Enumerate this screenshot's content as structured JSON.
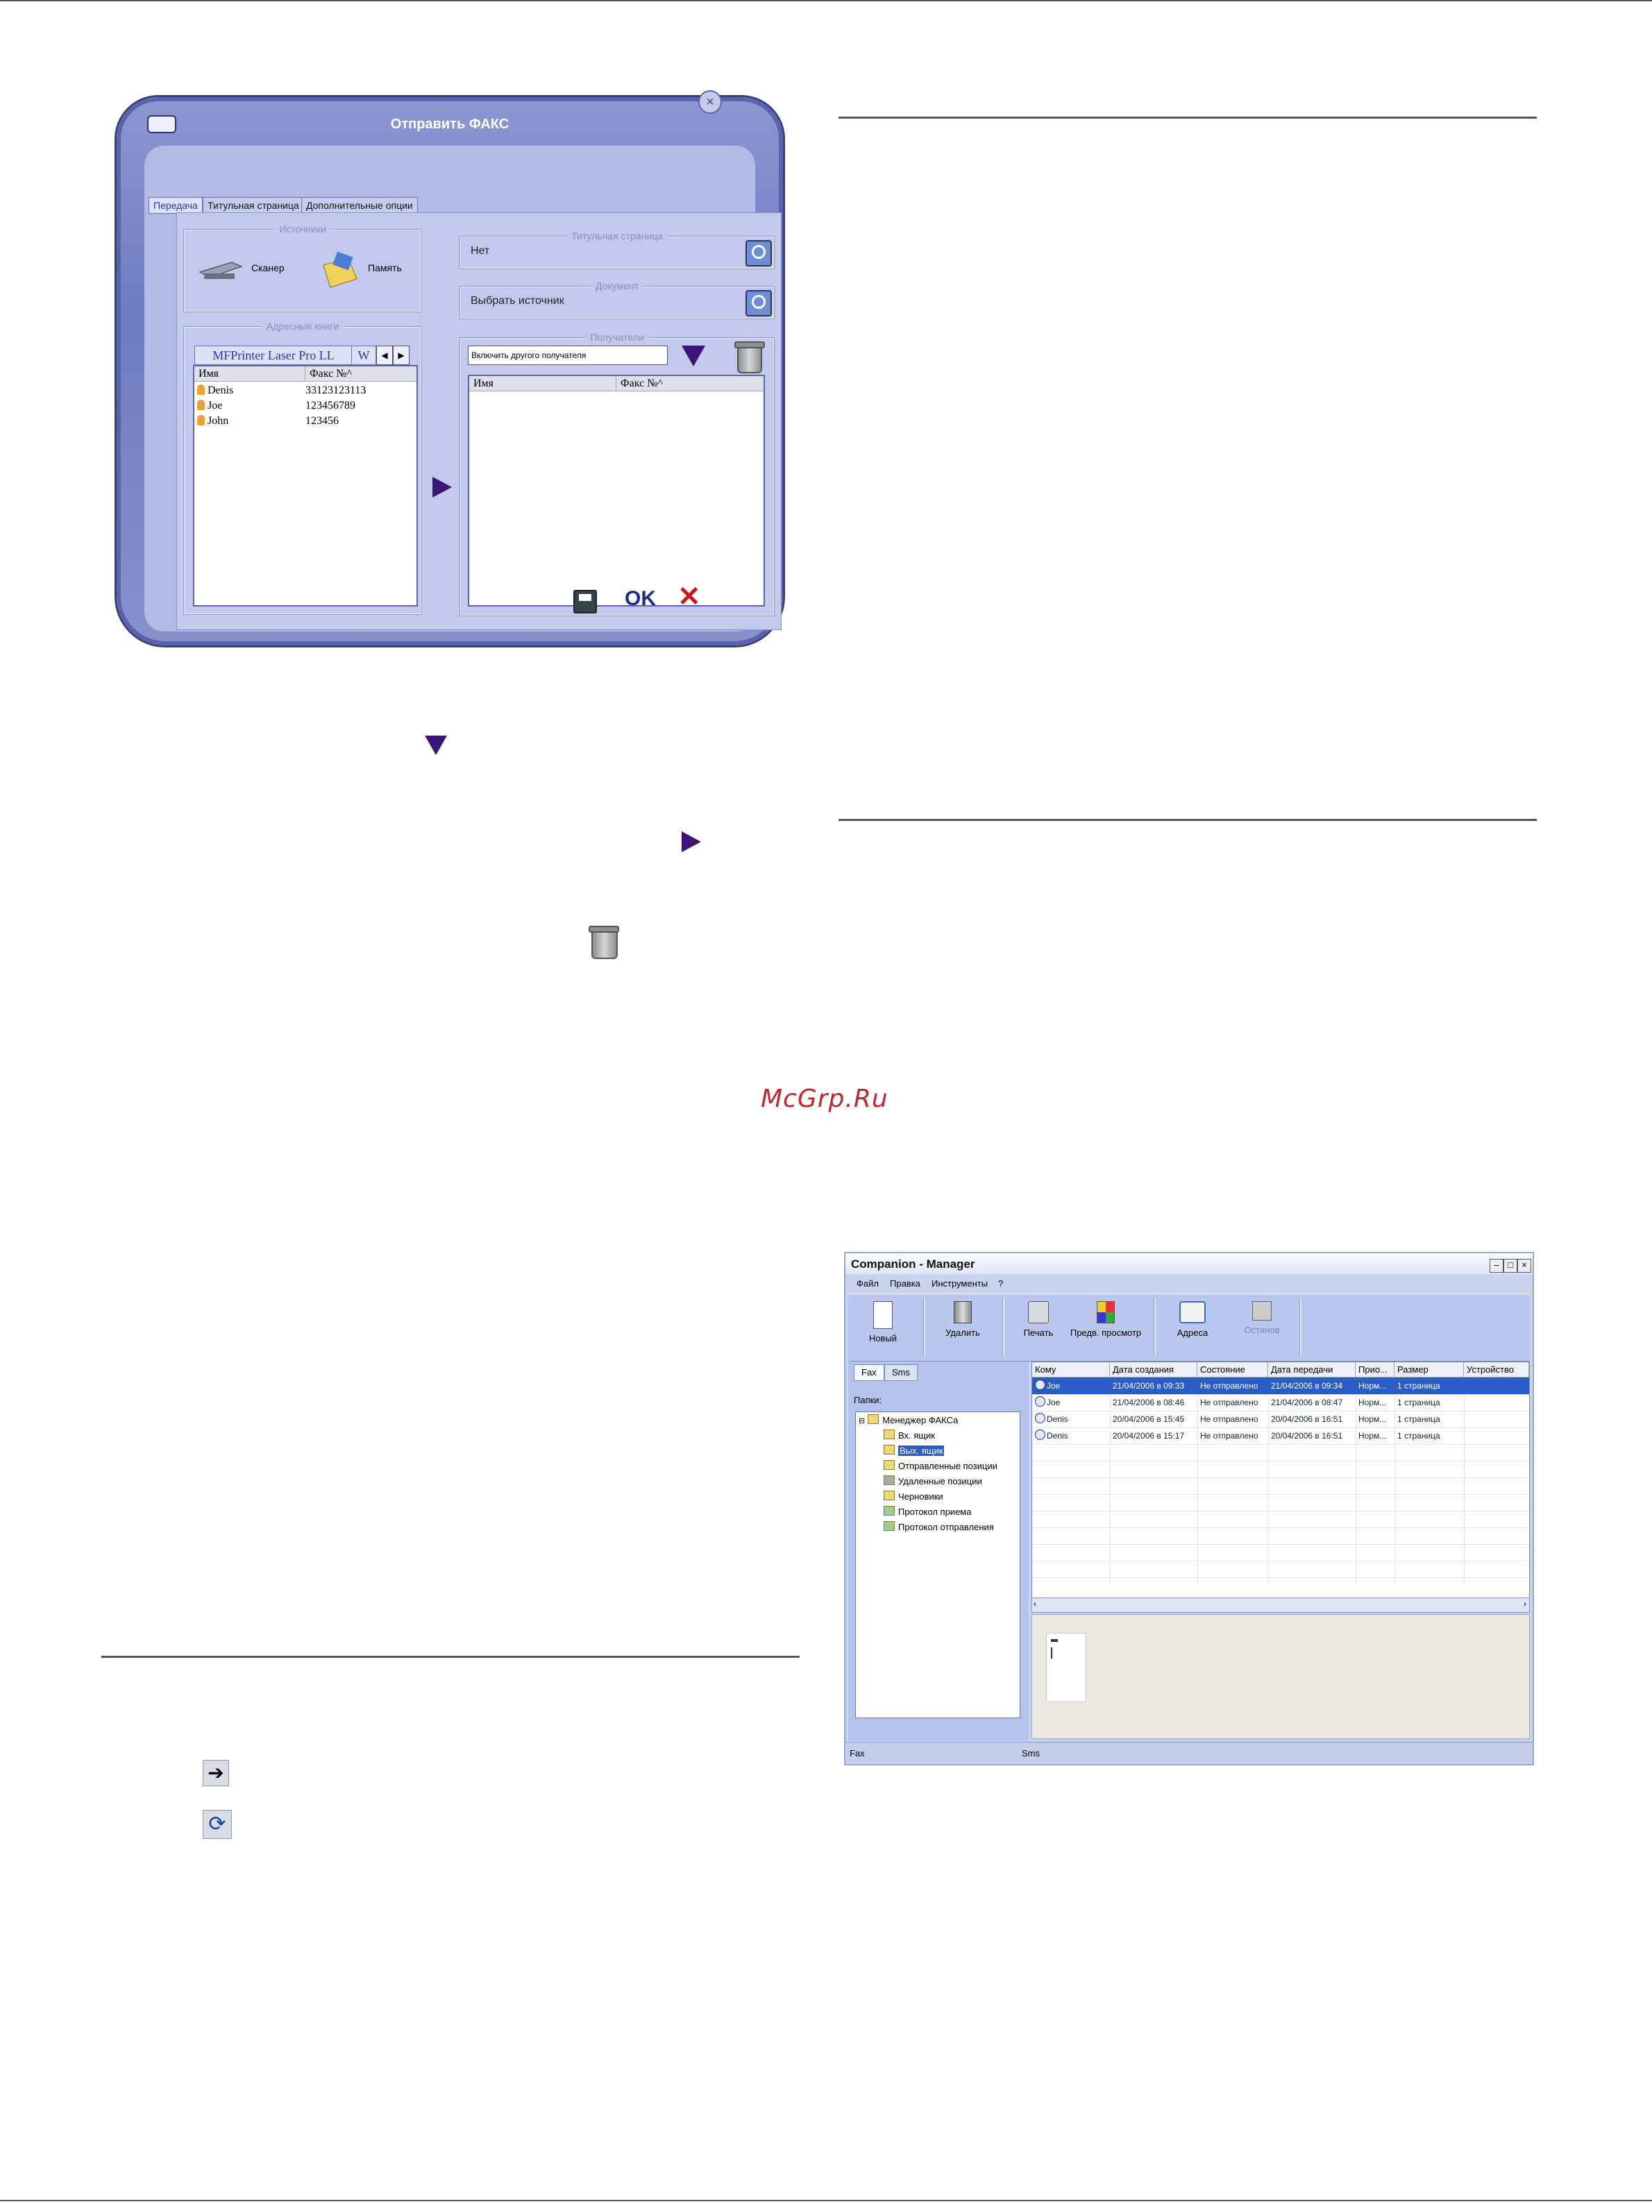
{
  "watermark": "McGrp.Ru",
  "fax_dialog": {
    "title": "Отправить ФАКС",
    "tabs": [
      "Передача",
      "Титульная страница",
      "Дополнительные опции"
    ],
    "sources": {
      "caption": "Источники",
      "scanner": "Сканер",
      "memory": "Память"
    },
    "address_books": {
      "caption": "Адресные книги",
      "book_tab": "MFPrinter Laser Pro LL",
      "book_tab_more": "W",
      "headers": [
        "Имя",
        "Факс №^"
      ],
      "rows": [
        {
          "name": "Denis",
          "fax": "33123123113"
        },
        {
          "name": "Joe",
          "fax": "123456789"
        },
        {
          "name": "John",
          "fax": "123456"
        }
      ]
    },
    "cover_page": {
      "caption": "Титульная страница",
      "value": "Нет"
    },
    "document": {
      "caption": "Документ",
      "value": "Выбрать источник"
    },
    "recipients": {
      "caption": "Получатели",
      "placeholder": "Включить другого получателя",
      "headers": [
        "Имя",
        "Факс №^"
      ]
    },
    "ok_label": "OK"
  },
  "companion_manager": {
    "title": "Companion - Manager",
    "menu": [
      "Файл",
      "Правка",
      "Инструменты",
      "?"
    ],
    "toolbar": [
      "Новый",
      "Удалить",
      "Печать",
      "Предв. просмотр",
      "Адреса",
      "Останов"
    ],
    "side_tabs": [
      "Fax",
      "Sms"
    ],
    "folders_label": "Папки:",
    "tree_root": "Менеджер ФАКСа",
    "tree_items": [
      "Вх. ящик",
      "Вых. ящик",
      "Отправленные позиции",
      "Удаленные позиции",
      "Черновики",
      "Протокол приема",
      "Протокол отправления"
    ],
    "columns": [
      "Кому",
      "Дата создания",
      "Состояние",
      "Дата передачи",
      "Прио...",
      "Размер",
      "Устройство"
    ],
    "rows": [
      [
        "Joe",
        "21/04/2006 в 09:33",
        "Не отправлено",
        "21/04/2006 в 09:34",
        "Норм...",
        "1 страница",
        ""
      ],
      [
        "Joe",
        "21/04/2006 в 08:46",
        "Не отправлено",
        "21/04/2006 в 08:47",
        "Норм...",
        "1 страница",
        ""
      ],
      [
        "Denis",
        "20/04/2006 в 15:45",
        "Не отправлено",
        "20/04/2006 в 16:51",
        "Норм...",
        "1 страница",
        ""
      ],
      [
        "Denis",
        "20/04/2006 в 15:17",
        "Не отправлено",
        "20/04/2006 в 16:51",
        "Норм...",
        "1 страница",
        ""
      ]
    ],
    "status": [
      "Fax",
      "Sms"
    ]
  },
  "colors": {
    "accent": "#3b1677",
    "selection": "#2a5cc8",
    "watermark": "#c1272d"
  }
}
